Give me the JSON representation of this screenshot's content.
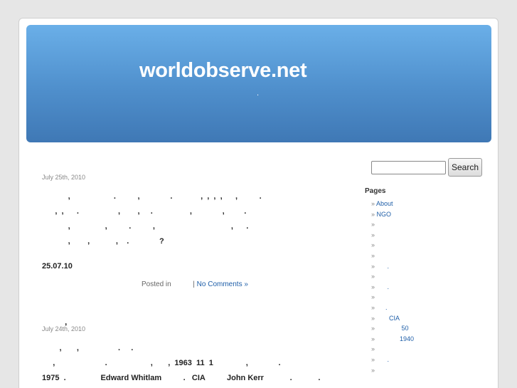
{
  "header": {
    "site_title": "worldobserve.net",
    "site_description": "."
  },
  "posts": [
    {
      "date": "July 25th, 2010",
      "lines": [
        "            ,                    .          ,              .             ,  ,  ,  ,      ,          .",
        "      ,  ,      .                  ,        ,     .                 ,              ,         .",
        "            ,                ,          .          ,                                   ,      .",
        "            ,        ,            ,    .              ?"
      ],
      "tag": "25.07.10",
      "posted_in": "Posted in",
      "separator": "|",
      "comments": "No Comments »"
    },
    {
      "title_mark": ",",
      "date": "July 24th, 2010",
      "lines": [
        "        ,       ,                  .     .",
        "     ,                       .                    ,       ,  1963  11  1               ,              .",
        "1975  .                Edward Whitlam          .   CIA          John Kerr            .            ."
      ]
    }
  ],
  "sidebar": {
    "search_placeholder": "",
    "search_button": "Search",
    "pages_heading": "Pages",
    "pages": [
      {
        "bullet": "»",
        "label": "About"
      },
      {
        "bullet": "»",
        "label": "NGO"
      },
      {
        "bullet": "»",
        "label": ""
      },
      {
        "bullet": "»",
        "label": ""
      },
      {
        "bullet": "»",
        "label": ""
      },
      {
        "bullet": "»",
        "label": ""
      },
      {
        "bullet": "»",
        "label": "      ."
      },
      {
        "bullet": "»",
        "label": ""
      },
      {
        "bullet": "»",
        "label": "      ."
      },
      {
        "bullet": "»",
        "label": ""
      },
      {
        "bullet": "»",
        "label": "     ."
      },
      {
        "bullet": "»",
        "label": "       CIA"
      },
      {
        "bullet": "»",
        "label": "              50"
      },
      {
        "bullet": "»",
        "label": "             1940"
      },
      {
        "bullet": "»",
        "label": ""
      },
      {
        "bullet": "»",
        "label": "      ."
      },
      {
        "bullet": "»",
        "label": ""
      }
    ]
  }
}
